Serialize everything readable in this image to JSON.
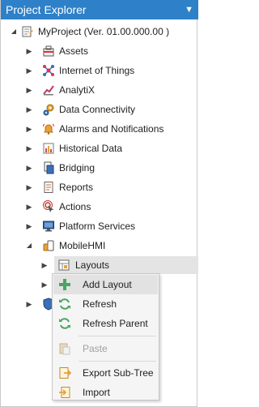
{
  "panel": {
    "title": "Project Explorer",
    "pin_glyph": "▼"
  },
  "tree": {
    "root": {
      "label": "MyProject (Ver. 01.00.000.00 )",
      "icon": "project-icon"
    },
    "items": [
      {
        "label": "Assets",
        "icon": "assets-icon"
      },
      {
        "label": "Internet of Things",
        "icon": "iot-icon"
      },
      {
        "label": "AnalytiX",
        "icon": "analytix-icon"
      },
      {
        "label": "Data Connectivity",
        "icon": "data-connectivity-icon"
      },
      {
        "label": "Alarms and Notifications",
        "icon": "alarm-bell-icon"
      },
      {
        "label": "Historical Data",
        "icon": "historical-data-icon"
      },
      {
        "label": "Bridging",
        "icon": "bridging-icon"
      },
      {
        "label": "Reports",
        "icon": "reports-icon"
      },
      {
        "label": "Actions",
        "icon": "actions-icon"
      },
      {
        "label": "Platform Services",
        "icon": "platform-services-icon"
      },
      {
        "label": "MobileHMI",
        "icon": "mobilehmi-icon"
      }
    ],
    "mobile_children": [
      {
        "label": "Layouts",
        "icon": "layouts-icon"
      }
    ]
  },
  "context_menu": {
    "items": [
      {
        "label": "Add Layout",
        "icon": "add-icon",
        "enabled": true
      },
      {
        "label": "Refresh",
        "icon": "refresh-icon",
        "enabled": true
      },
      {
        "label": "Refresh Parent",
        "icon": "refresh-parent-icon",
        "enabled": true
      },
      {
        "label": "Paste",
        "icon": "paste-icon",
        "enabled": false
      },
      {
        "label": "Export Sub-Tree",
        "icon": "export-icon",
        "enabled": true
      },
      {
        "label": "Import",
        "icon": "import-icon",
        "enabled": true
      }
    ]
  },
  "colors": {
    "header_bg": "#2e80c8",
    "selection_bg": "#e4e4e4",
    "menu_bg": "#f5f5f5",
    "add_green": "#4aa564"
  }
}
